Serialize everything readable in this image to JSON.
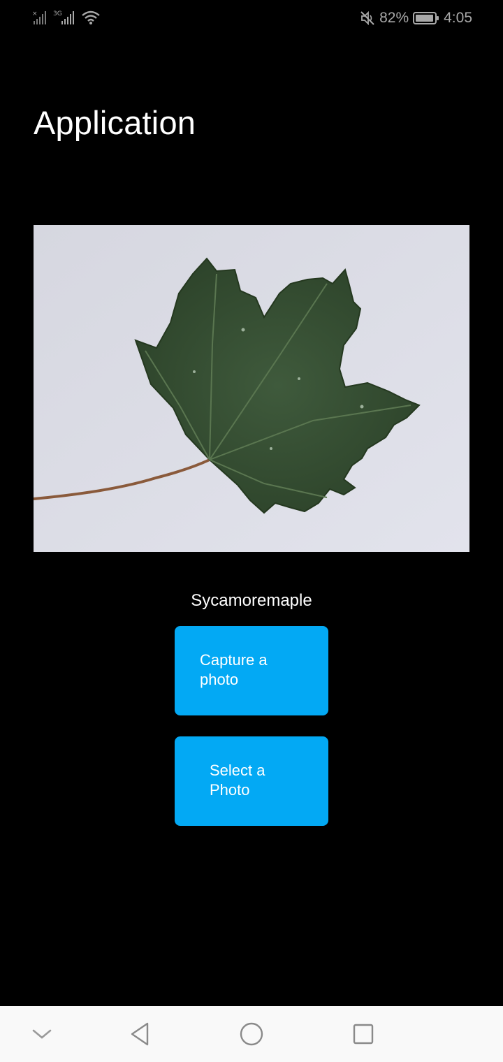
{
  "status_bar": {
    "network_type": "3G",
    "battery": "82%",
    "time": "4:05",
    "icons": [
      "no-sim-signal-icon",
      "signal-icon",
      "wifi-icon",
      "mute-icon",
      "battery-icon"
    ]
  },
  "page": {
    "title": "Application"
  },
  "image": {
    "subject": "leaf-photo"
  },
  "result": {
    "label": "Sycamoremaple"
  },
  "buttons": {
    "capture_label": "Capture a photo",
    "select_label": "Select a Photo"
  },
  "nav": {
    "icons": [
      "chevron-down-icon",
      "back-icon",
      "home-icon",
      "recent-apps-icon"
    ]
  },
  "colors": {
    "background": "#000000",
    "button": "#03a9f4",
    "nav_bar": "#f9f9f9",
    "status_text": "#a9a9a9"
  }
}
